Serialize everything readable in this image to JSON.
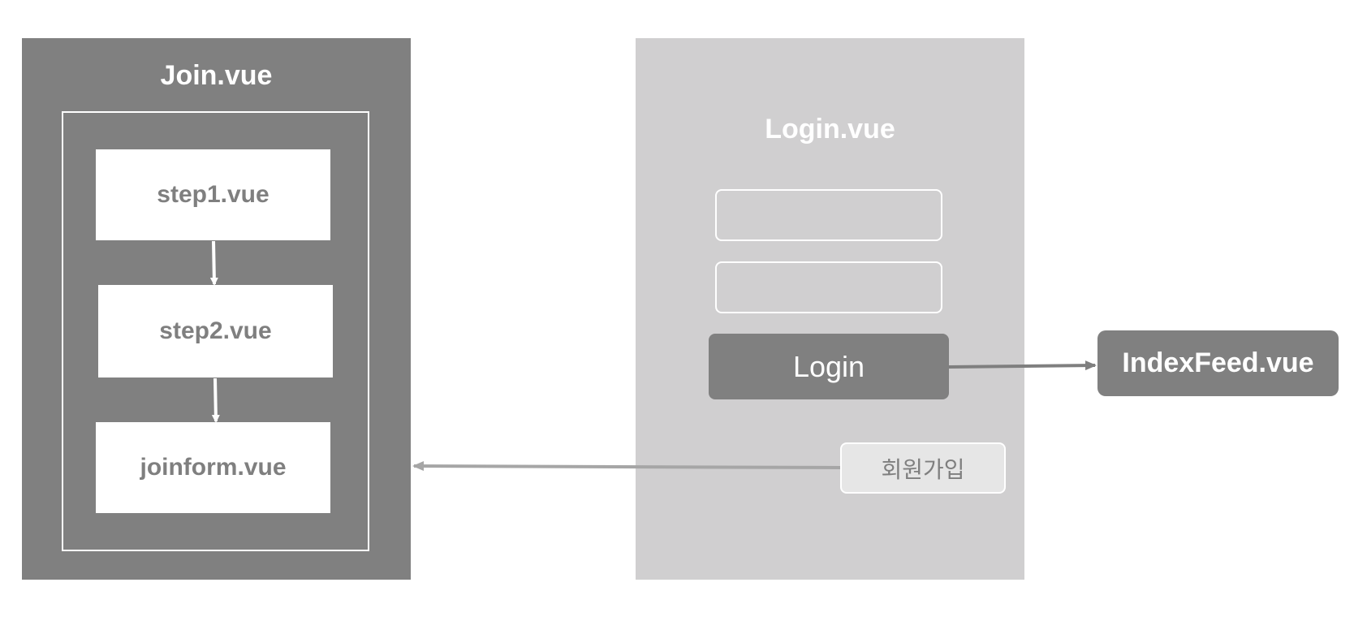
{
  "join": {
    "title": "Join.vue",
    "steps": [
      "step1.vue",
      "step2.vue",
      "joinform.vue"
    ]
  },
  "login": {
    "title": "Login.vue",
    "button_label": "Login",
    "signup_label": "회원가입"
  },
  "indexfeed": {
    "label": "IndexFeed.vue"
  },
  "colors": {
    "dark_gray": "#808080",
    "light_gray": "#d0cfd0",
    "arrow_white": "#ffffff",
    "arrow_dark": "#7f7f7f",
    "arrow_light": "#a6a6a6"
  }
}
